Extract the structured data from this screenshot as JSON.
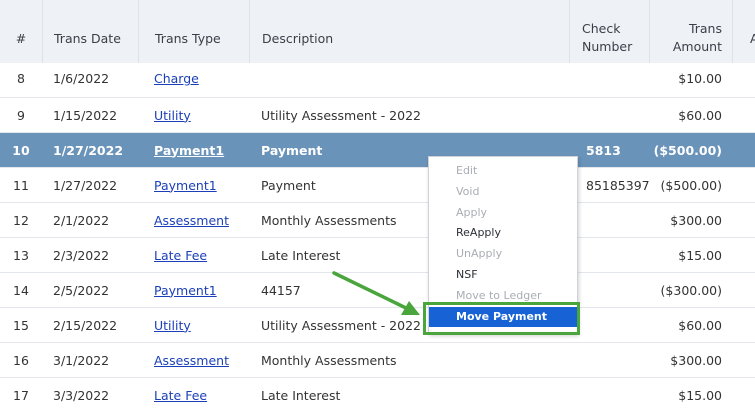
{
  "table": {
    "columns": {
      "num": "#",
      "trans_date": "Trans Date",
      "trans_type": "Trans Type",
      "description": "Description",
      "check_number_line1": "Check",
      "check_number_line2": "Number",
      "trans_amount_line1": "Trans",
      "trans_amount_line2": "Amount",
      "extra": "A"
    },
    "rows": [
      {
        "num": "8",
        "date": "1/6/2022",
        "type": "Charge",
        "desc": "",
        "check": "",
        "amount": "$10.00"
      },
      {
        "num": "9",
        "date": "1/15/2022",
        "type": "Utility",
        "desc": "Utility Assessment - 2022",
        "check": "",
        "amount": "$60.00"
      },
      {
        "num": "10",
        "date": "1/27/2022",
        "type": "Payment1",
        "desc": "Payment",
        "check": "5813",
        "amount": "($500.00)"
      },
      {
        "num": "11",
        "date": "1/27/2022",
        "type": "Payment1",
        "desc": "Payment",
        "check": "85185397",
        "amount": "($500.00)"
      },
      {
        "num": "12",
        "date": "2/1/2022",
        "type": "Assessment",
        "desc": "Monthly Assessments",
        "check": "",
        "amount": "$300.00"
      },
      {
        "num": "13",
        "date": "2/3/2022",
        "type": "Late Fee",
        "desc": "Late Interest",
        "check": "",
        "amount": "$15.00"
      },
      {
        "num": "14",
        "date": "2/5/2022",
        "type": "Payment1",
        "desc": "44157",
        "check": "",
        "amount": "($300.00)"
      },
      {
        "num": "15",
        "date": "2/15/2022",
        "type": "Utility",
        "desc": "Utility Assessment - 2022",
        "check": "",
        "amount": "$60.00"
      },
      {
        "num": "16",
        "date": "3/1/2022",
        "type": "Assessment",
        "desc": "Monthly Assessments",
        "check": "",
        "amount": "$300.00"
      },
      {
        "num": "17",
        "date": "3/3/2022",
        "type": "Late Fee",
        "desc": "Late Interest",
        "check": "",
        "amount": "$15.00"
      }
    ],
    "selected_row_num": "10"
  },
  "context_menu": {
    "items": [
      {
        "label": "Edit",
        "enabled": false
      },
      {
        "label": "Void",
        "enabled": false
      },
      {
        "label": "Apply",
        "enabled": false
      },
      {
        "label": "ReApply",
        "enabled": true
      },
      {
        "label": "UnApply",
        "enabled": false
      },
      {
        "label": "NSF",
        "enabled": true
      },
      {
        "label": "Move to Ledger",
        "enabled": false
      },
      {
        "label": "Move Payment",
        "enabled": true,
        "highlighted": true
      }
    ]
  },
  "colors": {
    "selected_row": "#6a93b9",
    "highlight": "#1763d6",
    "annotation": "#4aa63c",
    "link": "#1b3fb8"
  }
}
